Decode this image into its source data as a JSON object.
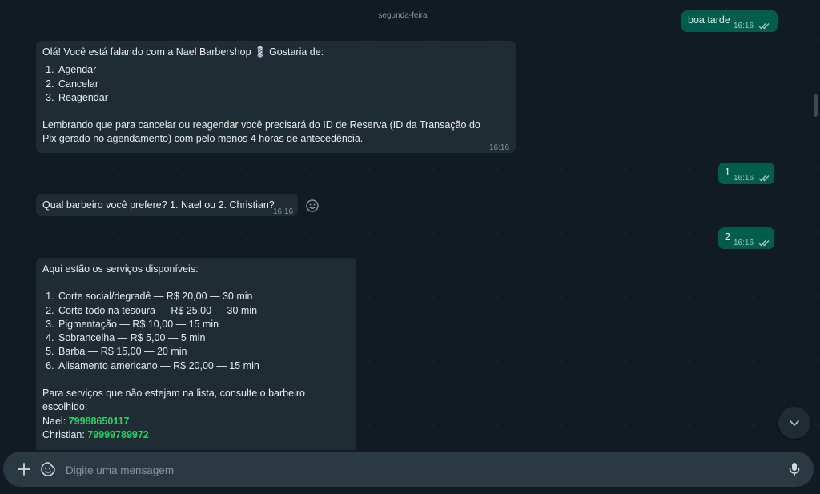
{
  "chat": {
    "day_label": "segunda-feira",
    "messages": {
      "m1": {
        "text": "boa tarde",
        "time": "16:16"
      },
      "m2": {
        "intro": "Olá! Você está falando com a Nael Barbershop 💈 Gostaria de:",
        "options": [
          "Agendar",
          "Cancelar",
          "Reagendar"
        ],
        "note": "Lembrando que para cancelar ou reagendar você precisará do ID de Reserva (ID da Transação do Pix gerado no agendamento) com pelo menos 4 horas de antecedência.",
        "time": "16:16"
      },
      "m3": {
        "text": "1",
        "time": "16:16"
      },
      "m4": {
        "text": "Qual barbeiro você prefere? 1. Nael ou 2. Christian?",
        "time": "16:16"
      },
      "m5": {
        "text": "2",
        "time": "16:16"
      },
      "m6": {
        "intro": "Aqui estão os serviços disponíveis:",
        "services": [
          "Corte social/degradê — R$ 20,00 — 30 min",
          "Corte todo na tesoura — R$ 25,00 — 30 min",
          "Pigmentação — R$ 10,00 — 15 min",
          "Sobrancelha — R$ 5,00 — 5 min",
          "Barba — R$ 15,00 — 20 min",
          "Alisamento americano — R$ 20,00 — 15 min"
        ],
        "footer": "Para serviços que não estejam na lista, consulte o barbeiro escolhido:",
        "contact1_name": "Nael:",
        "contact1_phone": "79988650117",
        "contact2_name": "Christian:",
        "contact2_phone": "79999789972"
      }
    }
  },
  "composer": {
    "placeholder": "Digite uma mensagem"
  },
  "colors": {
    "incoming_bubble": "#202c33",
    "outgoing_bubble": "#005c4b",
    "link": "#25d366",
    "background": "#111b21"
  },
  "icons": [
    "double-check-icon",
    "emoji-react-icon",
    "chevron-down-icon",
    "plus-icon",
    "sticker-icon",
    "microphone-icon"
  ]
}
